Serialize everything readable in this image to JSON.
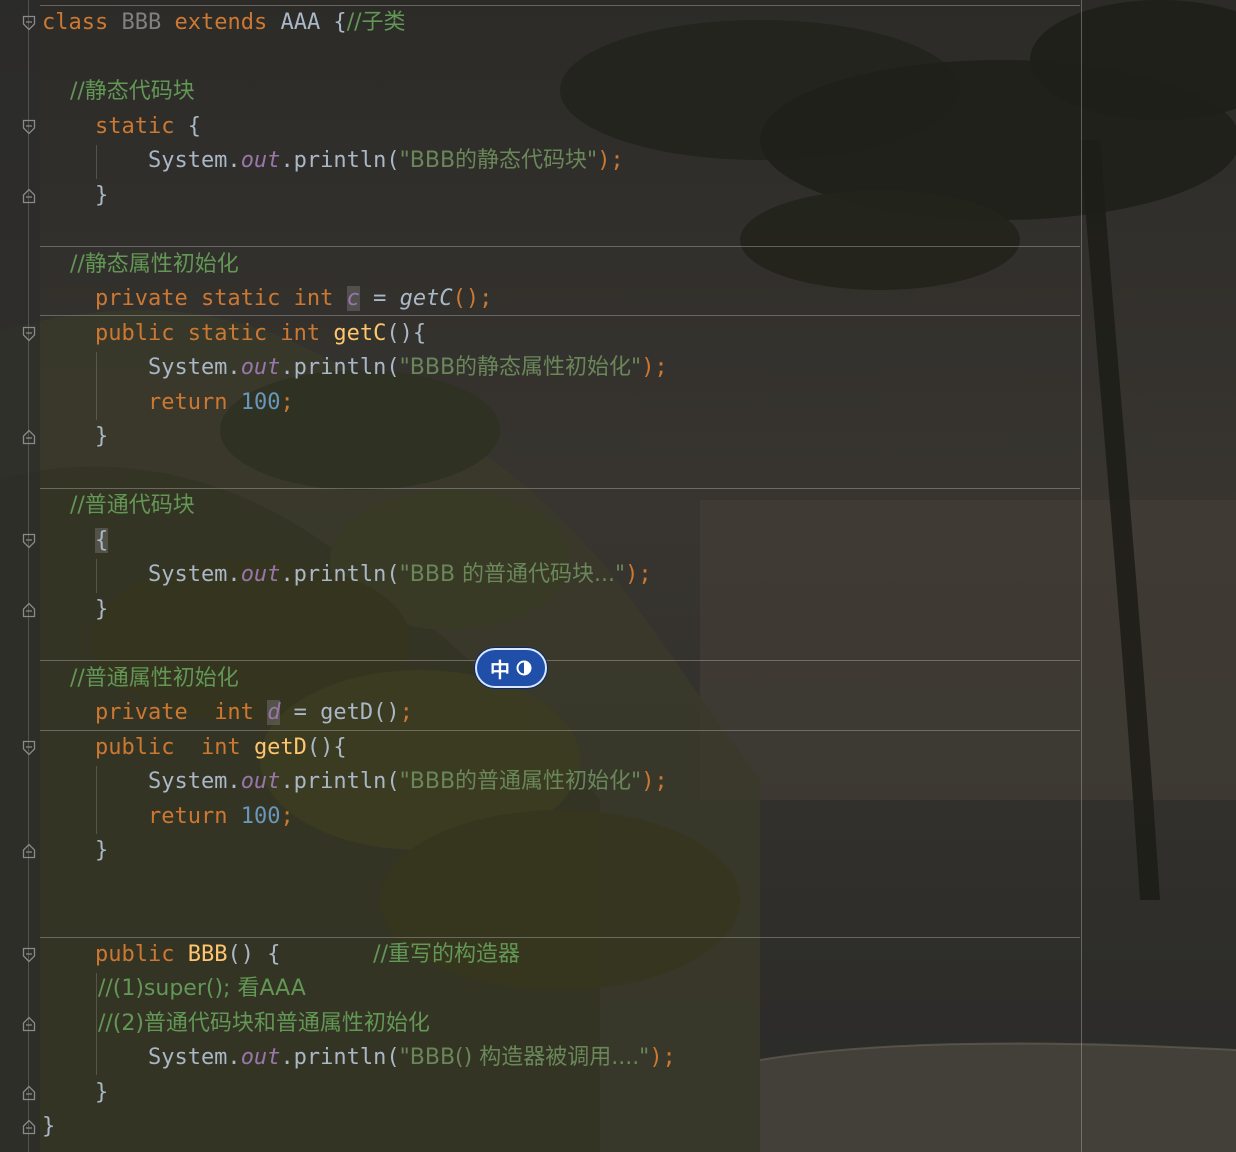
{
  "editor": {
    "lines": [
      {
        "tokens": [
          {
            "t": "class",
            "c": "kw"
          },
          {
            "t": " ",
            "c": "plain"
          },
          {
            "t": "BBB",
            "c": "dim"
          },
          {
            "t": " ",
            "c": "plain"
          },
          {
            "t": "extends",
            "c": "kw"
          },
          {
            "t": " AAA {",
            "c": "plain"
          },
          {
            "t": "//子类",
            "c": "cmt"
          }
        ]
      },
      {
        "tokens": []
      },
      {
        "tokens": [
          {
            "t": "    //静态代码块",
            "c": "cmt"
          }
        ]
      },
      {
        "tokens": [
          {
            "t": "    ",
            "c": "plain"
          },
          {
            "t": "static",
            "c": "kw"
          },
          {
            "t": " {",
            "c": "plain"
          }
        ]
      },
      {
        "tokens": [
          {
            "t": "        System.",
            "c": "plain"
          },
          {
            "t": "out",
            "c": "fld"
          },
          {
            "t": ".println(",
            "c": "plain"
          },
          {
            "t": "\"BBB的静态代码块\"",
            "c": "str"
          },
          {
            "t": ");",
            "c": "kw"
          }
        ]
      },
      {
        "tokens": [
          {
            "t": "    }",
            "c": "plain"
          }
        ]
      },
      {
        "tokens": []
      },
      {
        "tokens": [
          {
            "t": "    //静态属性初始化",
            "c": "cmt"
          }
        ]
      },
      {
        "tokens": [
          {
            "t": "    ",
            "c": "plain"
          },
          {
            "t": "private static int",
            "c": "kw"
          },
          {
            "t": " ",
            "c": "plain"
          },
          {
            "t": "c",
            "c": "fld hl"
          },
          {
            "t": " = ",
            "c": "plain"
          },
          {
            "t": "getC",
            "c": "plain ital"
          },
          {
            "t": "();",
            "c": "kw"
          }
        ]
      },
      {
        "tokens": [
          {
            "t": "    ",
            "c": "plain"
          },
          {
            "t": "public static int",
            "c": "kw"
          },
          {
            "t": " ",
            "c": "plain"
          },
          {
            "t": "getC",
            "c": "fn"
          },
          {
            "t": "(){",
            "c": "plain"
          }
        ]
      },
      {
        "tokens": [
          {
            "t": "        System.",
            "c": "plain"
          },
          {
            "t": "out",
            "c": "fld"
          },
          {
            "t": ".println(",
            "c": "plain"
          },
          {
            "t": "\"BBB的静态属性初始化\"",
            "c": "str"
          },
          {
            "t": ");",
            "c": "kw"
          }
        ]
      },
      {
        "tokens": [
          {
            "t": "        ",
            "c": "plain"
          },
          {
            "t": "return",
            "c": "kw"
          },
          {
            "t": " ",
            "c": "plain"
          },
          {
            "t": "100",
            "c": "num"
          },
          {
            "t": ";",
            "c": "kw"
          }
        ]
      },
      {
        "tokens": [
          {
            "t": "    }",
            "c": "plain"
          }
        ]
      },
      {
        "tokens": []
      },
      {
        "tokens": [
          {
            "t": "    //普通代码块",
            "c": "cmt"
          }
        ]
      },
      {
        "tokens": [
          {
            "t": "    ",
            "c": "plain"
          },
          {
            "t": "{",
            "c": "plain hl"
          }
        ]
      },
      {
        "tokens": [
          {
            "t": "        System.",
            "c": "plain"
          },
          {
            "t": "out",
            "c": "fld"
          },
          {
            "t": ".println(",
            "c": "plain"
          },
          {
            "t": "\"BBB 的普通代码块...\"",
            "c": "str"
          },
          {
            "t": ");",
            "c": "kw"
          }
        ]
      },
      {
        "tokens": [
          {
            "t": "    }",
            "c": "plain"
          }
        ]
      },
      {
        "tokens": []
      },
      {
        "tokens": [
          {
            "t": "    //普通属性初始化",
            "c": "cmt"
          }
        ]
      },
      {
        "tokens": [
          {
            "t": "    ",
            "c": "plain"
          },
          {
            "t": "private  int",
            "c": "kw"
          },
          {
            "t": " ",
            "c": "plain"
          },
          {
            "t": "d",
            "c": "fld hl"
          },
          {
            "t": " = getD()",
            "c": "plain"
          },
          {
            "t": ";",
            "c": "kw"
          }
        ]
      },
      {
        "tokens": [
          {
            "t": "    ",
            "c": "plain"
          },
          {
            "t": "public  int",
            "c": "kw"
          },
          {
            "t": " ",
            "c": "plain"
          },
          {
            "t": "getD",
            "c": "fn"
          },
          {
            "t": "(){",
            "c": "plain"
          }
        ]
      },
      {
        "tokens": [
          {
            "t": "        System.",
            "c": "plain"
          },
          {
            "t": "out",
            "c": "fld"
          },
          {
            "t": ".println(",
            "c": "plain"
          },
          {
            "t": "\"BBB的普通属性初始化\"",
            "c": "str"
          },
          {
            "t": ");",
            "c": "kw"
          }
        ]
      },
      {
        "tokens": [
          {
            "t": "        ",
            "c": "plain"
          },
          {
            "t": "return",
            "c": "kw"
          },
          {
            "t": " ",
            "c": "plain"
          },
          {
            "t": "100",
            "c": "num"
          },
          {
            "t": ";",
            "c": "kw"
          }
        ]
      },
      {
        "tokens": [
          {
            "t": "    }",
            "c": "plain"
          }
        ]
      },
      {
        "tokens": []
      },
      {
        "tokens": []
      },
      {
        "tokens": [
          {
            "t": "    ",
            "c": "plain"
          },
          {
            "t": "public",
            "c": "kw"
          },
          {
            "t": " ",
            "c": "plain"
          },
          {
            "t": "BBB",
            "c": "fn"
          },
          {
            "t": "() {       ",
            "c": "plain"
          },
          {
            "t": "//重写的构造器",
            "c": "cmt"
          }
        ]
      },
      {
        "tokens": [
          {
            "t": "        //(1)super(); 看AAA",
            "c": "cmt"
          }
        ]
      },
      {
        "tokens": [
          {
            "t": "        //(2)普通代码块和普通属性初始化",
            "c": "cmt"
          }
        ]
      },
      {
        "tokens": [
          {
            "t": "        System.",
            "c": "plain"
          },
          {
            "t": "out",
            "c": "fld"
          },
          {
            "t": ".println(",
            "c": "plain"
          },
          {
            "t": "\"BBB() 构造器被调用....\"",
            "c": "str"
          },
          {
            "t": ");",
            "c": "kw"
          }
        ]
      },
      {
        "tokens": [
          {
            "t": "    }",
            "c": "plain"
          }
        ]
      },
      {
        "tokens": [
          {
            "t": "}",
            "c": "plain"
          }
        ]
      }
    ]
  },
  "gutter": {
    "fold_icons": [
      {
        "line": 0,
        "kind": "open"
      },
      {
        "line": 3,
        "kind": "open"
      },
      {
        "line": 5,
        "kind": "close"
      },
      {
        "line": 9,
        "kind": "open"
      },
      {
        "line": 12,
        "kind": "close"
      },
      {
        "line": 15,
        "kind": "open"
      },
      {
        "line": 17,
        "kind": "close"
      },
      {
        "line": 21,
        "kind": "open"
      },
      {
        "line": 24,
        "kind": "close"
      },
      {
        "line": 27,
        "kind": "open"
      },
      {
        "line": 29,
        "kind": "close"
      },
      {
        "line": 31,
        "kind": "close"
      },
      {
        "line": 32,
        "kind": "close"
      }
    ]
  },
  "ime_indicator": {
    "label": "中",
    "mode_icon": "half-width-icon"
  },
  "colors": {
    "keyword": "#cc7832",
    "comment": "#629755",
    "string": "#6a8759",
    "field": "#9876aa",
    "number": "#6897bb",
    "method": "#ffc66d",
    "text": "#a9b7c6",
    "ime_bg": "#1f4fa8"
  }
}
